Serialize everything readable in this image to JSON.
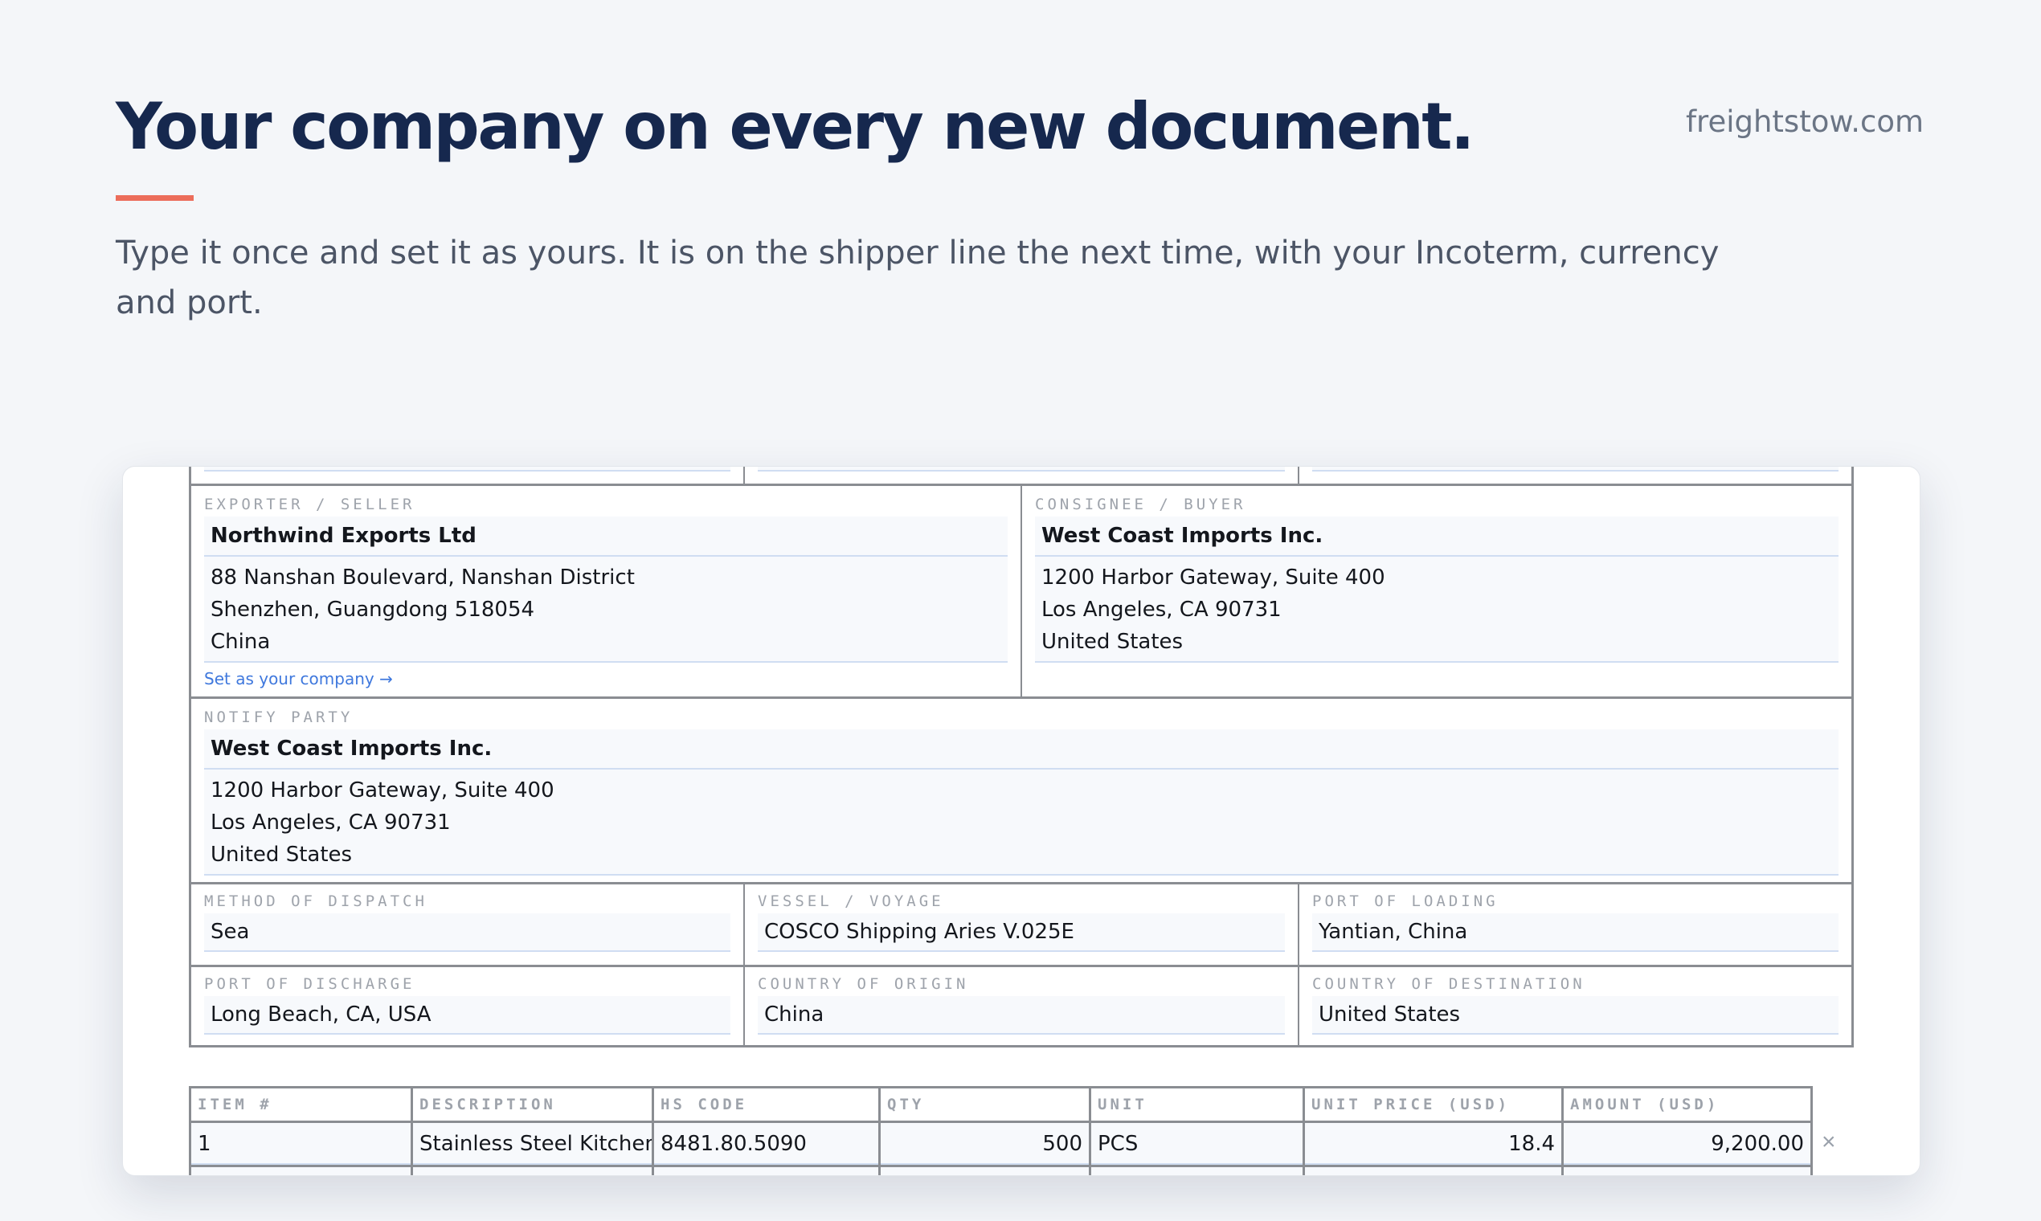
{
  "hero": {
    "headline": "Your company on every new document.",
    "site": "freightstow.com",
    "subhead": "Type it once and set it as yours. It is on the shipper line the next time, with your Incoterm, currency and port.",
    "accent_color": "#ec6d5b"
  },
  "document": {
    "exporter": {
      "label": "EXPORTER / SELLER",
      "name": "Northwind Exports Ltd",
      "address": [
        "88 Nanshan Boulevard, Nanshan District",
        "Shenzhen, Guangdong 518054",
        "China"
      ],
      "set_company_link": "Set as your company →"
    },
    "consignee": {
      "label": "CONSIGNEE / BUYER",
      "name": "West Coast Imports Inc.",
      "address": [
        "1200 Harbor Gateway, Suite 400",
        "Los Angeles, CA 90731",
        "United States"
      ]
    },
    "notify_party": {
      "label": "NOTIFY PARTY",
      "name": "West Coast Imports Inc.",
      "address": [
        "1200 Harbor Gateway, Suite 400",
        "Los Angeles, CA 90731",
        "United States"
      ]
    },
    "shipping": {
      "method_of_dispatch": {
        "label": "METHOD OF DISPATCH",
        "value": "Sea"
      },
      "vessel_voyage": {
        "label": "VESSEL / VOYAGE",
        "value": "COSCO Shipping Aries V.025E"
      },
      "port_of_loading": {
        "label": "PORT OF LOADING",
        "value": "Yantian, China"
      },
      "port_of_discharge": {
        "label": "PORT OF DISCHARGE",
        "value": "Long Beach, CA, USA"
      },
      "country_of_origin": {
        "label": "COUNTRY OF ORIGIN",
        "value": "China"
      },
      "country_of_destination": {
        "label": "COUNTRY OF DESTINATION",
        "value": "United States"
      }
    },
    "line_items": {
      "headers": [
        "ITEM #",
        "DESCRIPTION",
        "HS CODE",
        "QTY",
        "UNIT",
        "UNIT PRICE (USD)",
        "AMOUNT (USD)"
      ],
      "rows": [
        {
          "item": "1",
          "description": "Stainless Steel Kitchen Faucet",
          "hs_code": "8481.80.5090",
          "qty": "500",
          "unit": "PCS",
          "unit_price": "18.4",
          "amount": "9,200.00"
        }
      ],
      "remove_glyph": "×"
    }
  }
}
